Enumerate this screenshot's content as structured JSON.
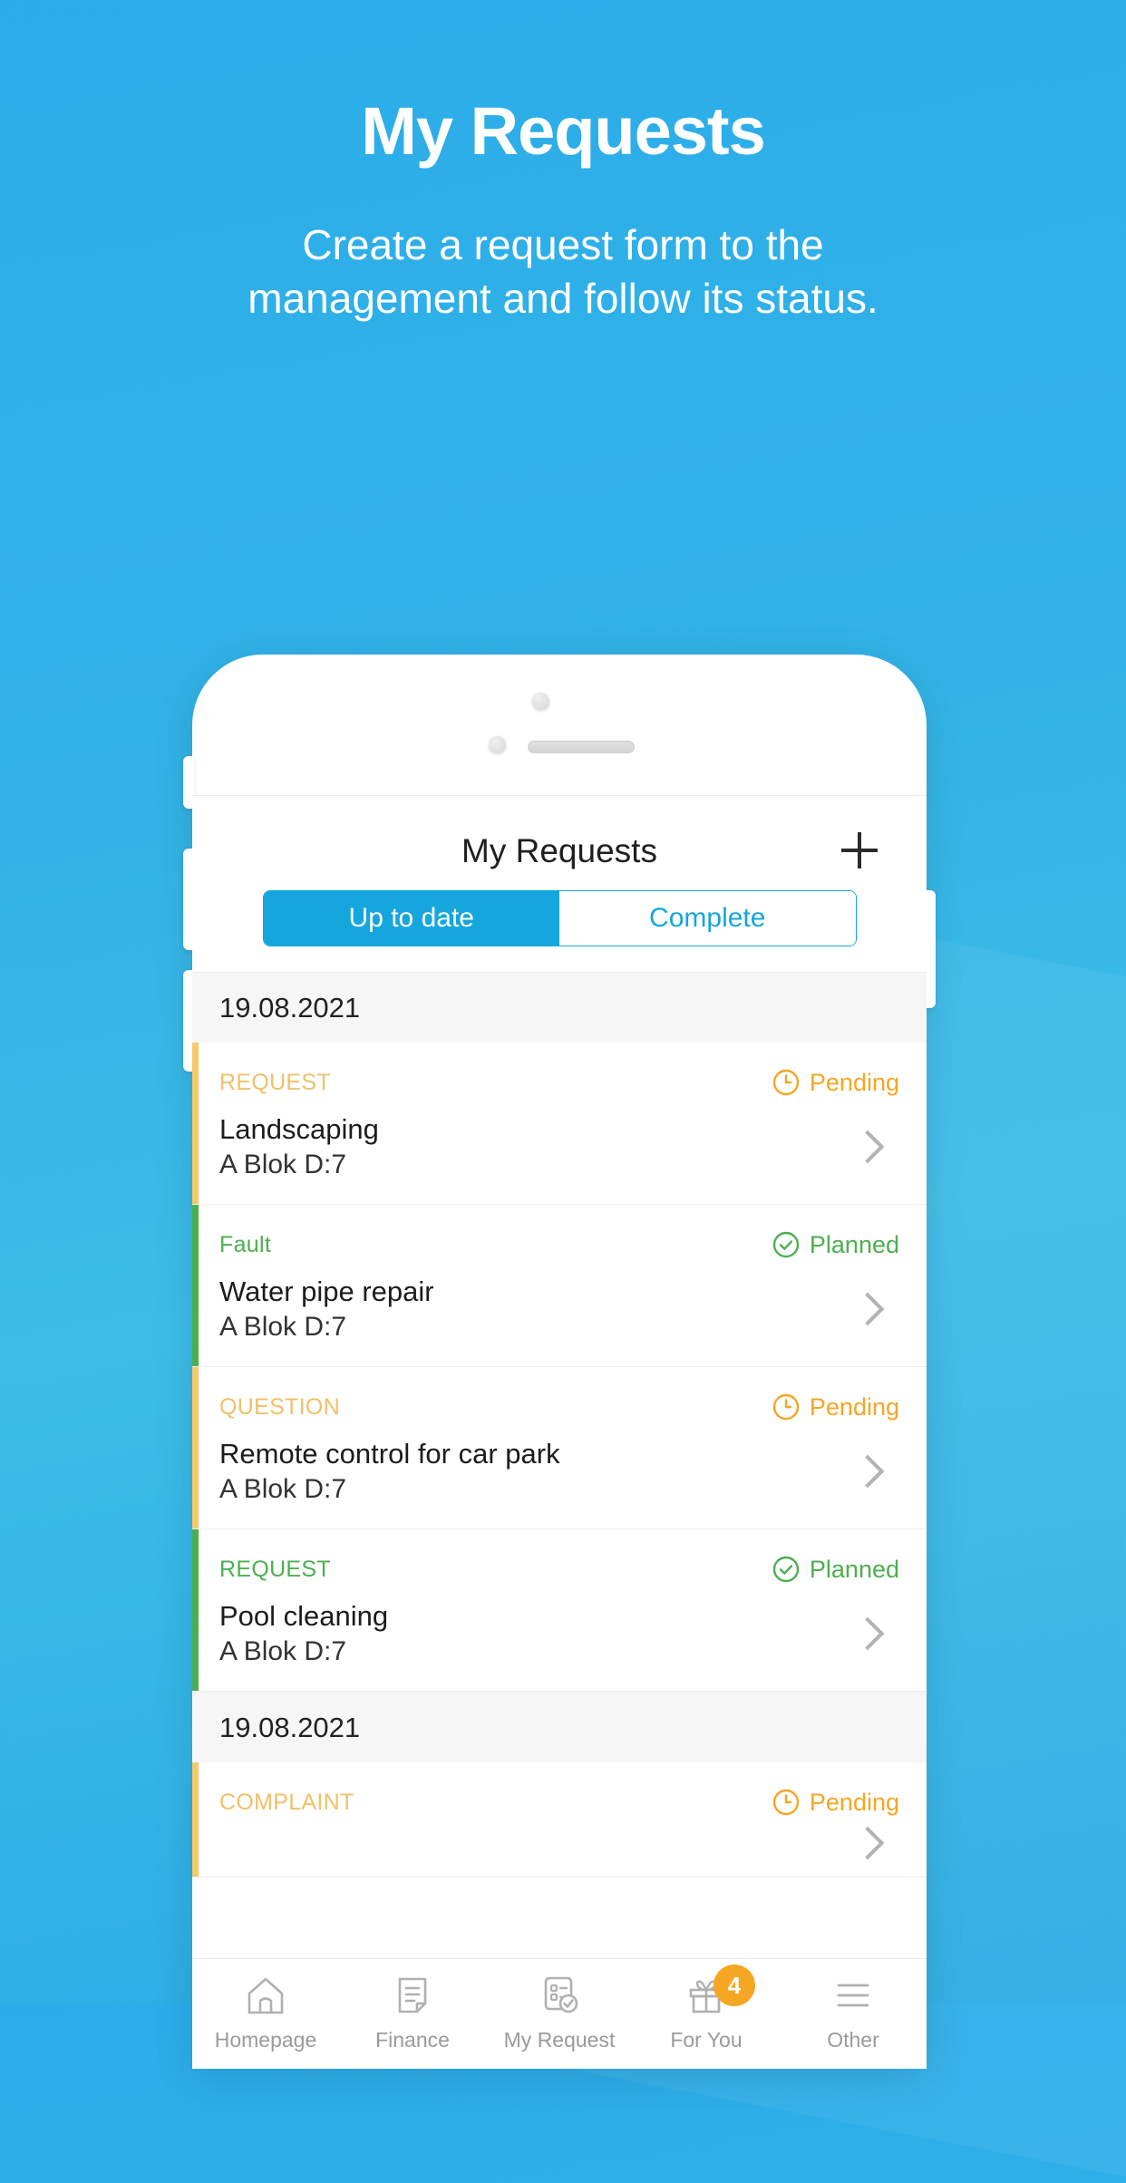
{
  "hero": {
    "title": "My Requests",
    "subtitle": "Create a request form to the management and follow its status."
  },
  "colors": {
    "background_top": "#2badea",
    "background_bottom": "#2aabe4",
    "accent_blue": "#14a6dd",
    "pending_orange": "#f5a623",
    "planned_green": "#4caf50",
    "badge_orange": "#f5a623"
  },
  "app": {
    "header": {
      "title": "My Requests",
      "add_icon": "plus-icon"
    },
    "tabs": [
      {
        "label": "Up to date",
        "active": true
      },
      {
        "label": "Complete",
        "active": false
      }
    ],
    "groups": [
      {
        "date": "19.08.2021",
        "items": [
          {
            "type": "REQUEST",
            "title": "Landscaping",
            "location": "A Blok D:7",
            "status": "Pending",
            "status_icon": "clock-icon",
            "accent": "#f6c96a",
            "type_color": "#f0c069",
            "status_color": "#f5a623"
          },
          {
            "type": "Fault",
            "title": "Water pipe repair",
            "location": "A Blok D:7",
            "status": "Planned",
            "status_icon": "check-circle-icon",
            "accent": "#4caf50",
            "type_color": "#4caf50",
            "status_color": "#4caf50"
          },
          {
            "type": "QUESTION",
            "title": "Remote control for car park",
            "location": "A Blok D:7",
            "status": "Pending",
            "status_icon": "clock-icon",
            "accent": "#f6c96a",
            "type_color": "#f0c069",
            "status_color": "#f5a623"
          },
          {
            "type": "REQUEST",
            "title": "Pool cleaning",
            "location": "A Blok D:7",
            "status": "Planned",
            "status_icon": "check-circle-icon",
            "accent": "#4caf50",
            "type_color": "#4caf50",
            "status_color": "#4caf50"
          }
        ]
      },
      {
        "date": "19.08.2021",
        "items": [
          {
            "type": "COMPLAINT",
            "title": "",
            "location": "",
            "status": "Pending",
            "status_icon": "clock-icon",
            "accent": "#f6c96a",
            "type_color": "#f0c069",
            "status_color": "#f5a623"
          }
        ]
      }
    ],
    "tabbar": [
      {
        "label": "Homepage",
        "icon": "home-icon",
        "badge": null
      },
      {
        "label": "Finance",
        "icon": "document-icon",
        "badge": null
      },
      {
        "label": "My Request",
        "icon": "checklist-icon",
        "badge": null
      },
      {
        "label": "For You",
        "icon": "gift-icon",
        "badge": "4"
      },
      {
        "label": "Other",
        "icon": "hamburger-icon",
        "badge": null
      }
    ]
  }
}
